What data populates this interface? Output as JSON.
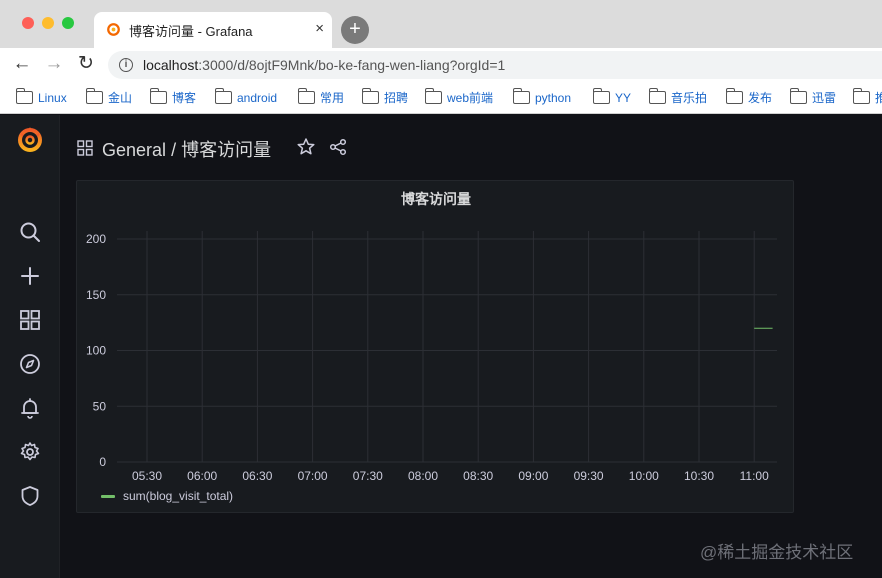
{
  "browser": {
    "tab_title": "博客访问量 - Grafana",
    "tab_close": "×",
    "newtab": "+",
    "url_host": "localhost",
    "url_rest": ":3000/d/8ojtF9Mnk/bo-ke-fang-wen-liang?orgId=1",
    "bookmarks": [
      "Linux",
      "金山",
      "博客",
      "android",
      "常用",
      "招聘",
      "web前端",
      "python",
      "YY",
      "音乐拍",
      "发布",
      "迅雷",
      "推"
    ]
  },
  "grafana": {
    "breadcrumb_folder": "General",
    "breadcrumb_sep": "/",
    "dashboard_title": "博客访问量",
    "panel": {
      "title": "博客访问量",
      "legend": "sum(blog_visit_total)",
      "series_color": "#73bf69"
    },
    "side_icons": [
      "search-icon",
      "plus-icon",
      "dashboards-icon",
      "explore-icon",
      "alert-bell-icon",
      "gear-icon",
      "shield-icon"
    ]
  },
  "chart_data": {
    "type": "line",
    "title": "博客访问量",
    "x_ticks": [
      "05:30",
      "06:00",
      "06:30",
      "07:00",
      "07:30",
      "08:00",
      "08:30",
      "09:00",
      "09:30",
      "10:00",
      "10:30",
      "11:00"
    ],
    "y_ticks": [
      0,
      50,
      100,
      150,
      200
    ],
    "ylim": [
      0,
      200
    ],
    "series": [
      {
        "name": "sum(blog_visit_total)",
        "color": "#73bf69",
        "x": [
          "11:00",
          "11:10"
        ],
        "y": [
          120,
          120
        ]
      }
    ],
    "grid": true,
    "legend_position": "bottom-left"
  },
  "watermark": "@稀土掘金技术社区"
}
